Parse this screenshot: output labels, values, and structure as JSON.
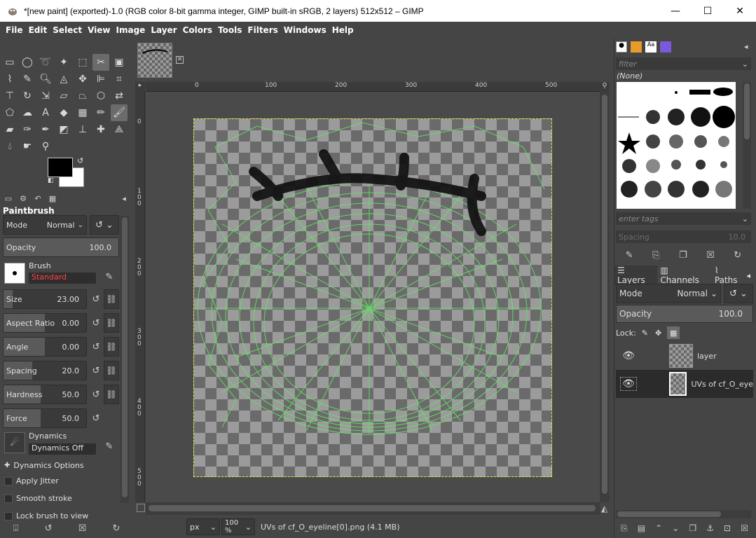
{
  "window": {
    "title": "*[new paint] (exported)-1.0 (RGB color 8-bit gamma integer, GIMP built-in sRGB, 2 layers) 512x512 – GIMP",
    "minimize": "—",
    "maximize": "☐",
    "close": "✕"
  },
  "menu": [
    "File",
    "Edit",
    "Select",
    "View",
    "Image",
    "Layer",
    "Colors",
    "Tools",
    "Filters",
    "Windows",
    "Help"
  ],
  "tool_options": {
    "title": "Paintbrush",
    "mode_label": "Mode",
    "mode_value": "Normal",
    "opacity_label": "Opacity",
    "opacity_value": "100.0",
    "brush_label": "Brush",
    "brush_value": "Standard",
    "size_label": "Size",
    "size_value": "23.00",
    "aspect_label": "Aspect Ratio",
    "aspect_value": "0.00",
    "angle_label": "Angle",
    "angle_value": "0.00",
    "spacing_label": "Spacing",
    "spacing_value": "20.0",
    "hardness_label": "Hardness",
    "hardness_value": "50.0",
    "force_label": "Force",
    "force_value": "50.0",
    "dynamics_label": "Dynamics",
    "dynamics_value": "Dynamics Off",
    "dynamics_options": "Dynamics Options",
    "apply_jitter": "Apply Jitter",
    "smooth_stroke": "Smooth stroke",
    "lock_brush": "Lock brush to view"
  },
  "ruler": {
    "h_ticks": [
      "0",
      "100",
      "200",
      "300",
      "400",
      "500"
    ],
    "v_ticks": [
      "0",
      "100",
      "200",
      "300",
      "400",
      "500"
    ]
  },
  "status": {
    "unit": "px",
    "zoom": "100 %",
    "info": "UVs of cf_O_eyeline[0].png (4.1 MB)"
  },
  "brushes_panel": {
    "filter_placeholder": "filter",
    "selected": "(None)",
    "tags_placeholder": "enter tags",
    "spacing_label": "Spacing",
    "spacing_value": "10.0"
  },
  "layers_panel": {
    "tabs": [
      "Layers",
      "Channels",
      "Paths"
    ],
    "mode_label": "Mode",
    "mode_value": "Normal",
    "opacity_label": "Opacity",
    "opacity_value": "100.0",
    "lock_label": "Lock:",
    "layers": [
      "layer",
      "UVs of cf_O_eye"
    ]
  },
  "colors": {
    "foreground": "#000000",
    "background": "#ffffff",
    "uv_lines": "#66e066",
    "selection_border": "#e8e84a"
  }
}
